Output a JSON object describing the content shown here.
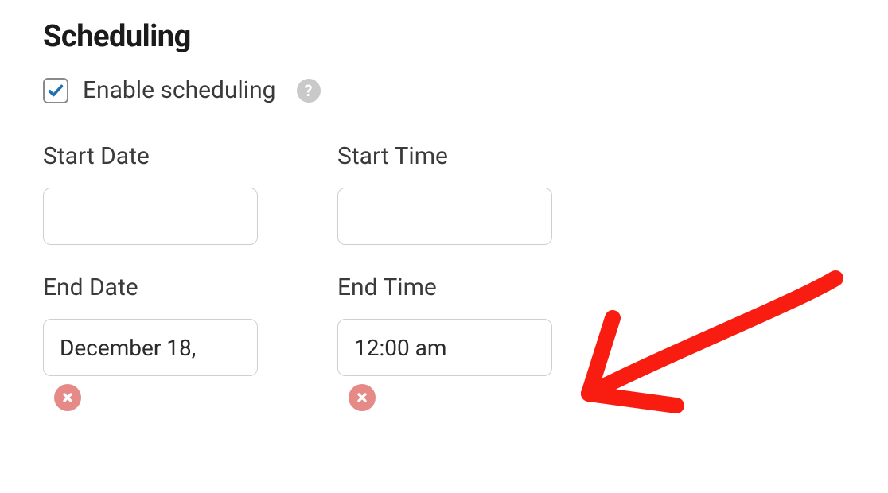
{
  "section": {
    "title": "Scheduling"
  },
  "enable": {
    "label": "Enable scheduling",
    "checked": true
  },
  "fields": {
    "start_date": {
      "label": "Start Date",
      "value": ""
    },
    "start_time": {
      "label": "Start Time",
      "value": ""
    },
    "end_date": {
      "label": "End Date",
      "value": "December 18,"
    },
    "end_time": {
      "label": "End Time",
      "value": "12:00 am"
    }
  },
  "colors": {
    "check": "#2170b0",
    "clear_bg": "#e58a87",
    "arrow": "#f91d11"
  }
}
